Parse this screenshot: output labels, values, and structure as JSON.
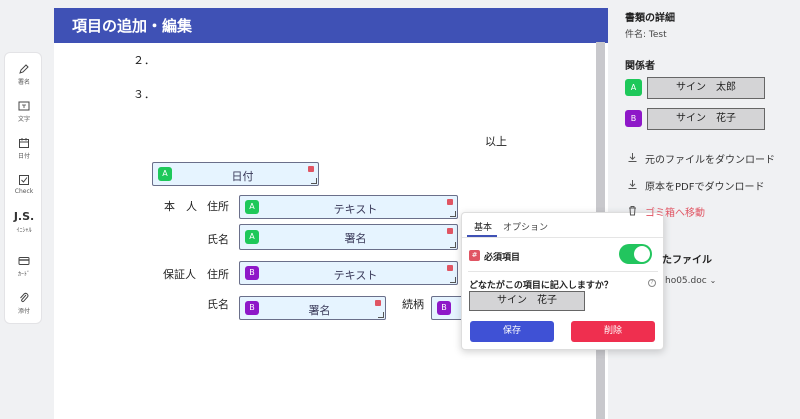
{
  "toolbar": {
    "items": [
      {
        "label": "署名",
        "icon": "pen-icon"
      },
      {
        "label": "文字",
        "icon": "text-box-icon"
      },
      {
        "label": "日付",
        "icon": "calendar-icon"
      },
      {
        "label": "Check",
        "icon": "checkbox-icon"
      },
      {
        "label": "ｲﾆｼｬﾙ",
        "icon": "initials-icon",
        "glyph": "J.S."
      },
      {
        "label": "ｶｰﾄﾞ",
        "icon": "card-icon"
      },
      {
        "label": "添付",
        "icon": "paperclip-icon"
      }
    ]
  },
  "document": {
    "title": "項目の追加・編集",
    "text": {
      "item2": "２．",
      "item3": "３．",
      "ijou": "以上",
      "honnin": "本　人",
      "jusho1": "住所",
      "shimei1": "氏名",
      "hoshounin": "保証人",
      "jusho2": "住所",
      "shimei2": "氏名",
      "zokugara": "続柄"
    },
    "fields": [
      {
        "signer": "A",
        "label": "日付"
      },
      {
        "signer": "A",
        "label": "テキスト"
      },
      {
        "signer": "A",
        "label": "署名"
      },
      {
        "signer": "B",
        "label": "テキスト"
      },
      {
        "signer": "B",
        "label": "署名"
      },
      {
        "signer": "B",
        "label": ""
      }
    ]
  },
  "popup": {
    "tabs": [
      "基本",
      "オプション"
    ],
    "required_icon": "required-icon",
    "required_label": "必須項目",
    "required_on": true,
    "question": "どなたがこの項目に記入しますか？",
    "selected_signer": "サイン　花子",
    "save_label": "保存",
    "delete_label": "削除"
  },
  "panel": {
    "details_title": "書類の詳細",
    "subject_line": "件名: Test",
    "parties_title": "関係者",
    "signers": [
      {
        "letter": "A",
        "name": "サイン　太郎"
      },
      {
        "letter": "B",
        "name": "サイン　花子"
      }
    ],
    "actions": {
      "download_original": "元のファイルをダウンロード",
      "download_pdf": "原本をPDFでダウンロード",
      "move_trash": "ゴミ箱へ移動"
    },
    "files_title_partial": "たファイル",
    "file_name_partial": "ho05.doc"
  },
  "colors": {
    "header": "#3f51b5",
    "signer_a": "#1ec85a",
    "signer_b": "#8e18c8",
    "save": "#3f51d5",
    "delete": "#ef2f4f",
    "toggle_on": "#22c55e"
  }
}
